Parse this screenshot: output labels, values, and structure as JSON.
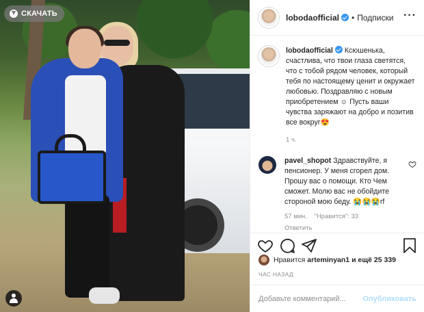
{
  "photo": {
    "download_label": "СКАЧАТЬ",
    "download_icon": "download-icon",
    "user_tag_icon": "user-tag-icon"
  },
  "header": {
    "username": "lobodaofficial",
    "dot": "•",
    "follow_label": "Подписки",
    "more_icon": "more-options-icon"
  },
  "caption": {
    "username": "lobodaofficial",
    "text": "Ксюшенька, счастлива, что твои глаза светятся, что с тобой рядом человек, который тебя по настоящему ценит и окружает любовью. Поздравляю с новым приобретением ☺ Пусть ваши чувства заряжают на добро и позитив все вокруг😍",
    "time": "1 ч."
  },
  "comment": {
    "username": "pavel_shopot",
    "text": "Здравствуйте, я пенсионер. У меня сгорел дом. Прошу вас о помощи. Кто Чем сможет. Молю вас не обойдите стороной мою беду. 😭😭😭rf",
    "time": "57 мин.",
    "likes": "\"Нравится\": 33",
    "reply_label": "Ответить"
  },
  "actions": {
    "like_icon": "heart-icon",
    "comment_icon": "comment-icon",
    "share_icon": "share-icon",
    "save_icon": "bookmark-icon"
  },
  "likes": {
    "prefix": "Нравится",
    "user": "arteminyan1",
    "suffix": "и ещё 25 339"
  },
  "time_ago": "ЧАС НАЗАД",
  "comment_box": {
    "placeholder": "Добавьте комментарий...",
    "post_label": "Опубликовать"
  },
  "colors": {
    "accent": "#3897f0",
    "post_disabled": "#b2dffc",
    "muted": "#8e8e8e"
  }
}
